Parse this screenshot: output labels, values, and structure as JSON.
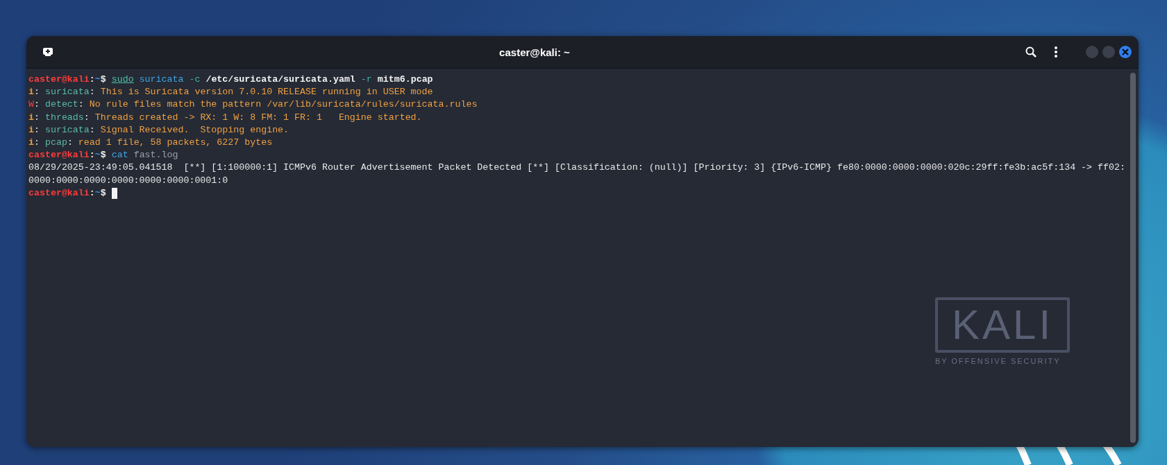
{
  "window": {
    "title": "caster@kali: ~",
    "controls": [
      {
        "kind": "minimize"
      },
      {
        "kind": "maximize"
      },
      {
        "kind": "close"
      }
    ]
  },
  "terminal": {
    "lines": [
      {
        "segments": [
          {
            "kind": "user",
            "text": "caster@kali"
          },
          {
            "kind": "sep",
            "text": ":"
          },
          {
            "kind": "path",
            "text": "~"
          },
          {
            "kind": "sep",
            "text": "$ "
          },
          {
            "kind": "precommand",
            "text": "sudo"
          },
          {
            "kind": "command",
            "text": " suricata"
          },
          {
            "kind": "flag",
            "text": " -c"
          },
          {
            "kind": "arg",
            "text": " /etc/suricata/suricata.yaml"
          },
          {
            "kind": "flag",
            "text": " -r"
          },
          {
            "kind": "arg",
            "text": " mitm6.pcap"
          }
        ]
      },
      {
        "segments": [
          {
            "kind": "info",
            "text": "i"
          },
          {
            "kind": "plain",
            "text": ": "
          },
          {
            "kind": "module",
            "text": "suricata"
          },
          {
            "kind": "plain",
            "text": ": "
          },
          {
            "kind": "message",
            "text": "This is Suricata version 7.0.10 RELEASE running in USER mode"
          }
        ]
      },
      {
        "segments": [
          {
            "kind": "warn",
            "text": "W"
          },
          {
            "kind": "plain",
            "text": ": "
          },
          {
            "kind": "module",
            "text": "detect"
          },
          {
            "kind": "plain",
            "text": ": "
          },
          {
            "kind": "message",
            "text": "No rule files match the pattern /var/lib/suricata/rules/suricata.rules"
          }
        ]
      },
      {
        "segments": [
          {
            "kind": "info",
            "text": "i"
          },
          {
            "kind": "plain",
            "text": ": "
          },
          {
            "kind": "module",
            "text": "threads"
          },
          {
            "kind": "plain",
            "text": ": "
          },
          {
            "kind": "message",
            "text": "Threads created -> RX: 1 W: 8 FM: 1 FR: 1   Engine started."
          }
        ]
      },
      {
        "segments": [
          {
            "kind": "info",
            "text": "i"
          },
          {
            "kind": "plain",
            "text": ": "
          },
          {
            "kind": "module",
            "text": "suricata"
          },
          {
            "kind": "plain",
            "text": ": "
          },
          {
            "kind": "message",
            "text": "Signal Received.  Stopping engine."
          }
        ]
      },
      {
        "segments": [
          {
            "kind": "info",
            "text": "i"
          },
          {
            "kind": "plain",
            "text": ": "
          },
          {
            "kind": "module",
            "text": "pcap"
          },
          {
            "kind": "plain",
            "text": ": "
          },
          {
            "kind": "message",
            "text": "read 1 file, 58 packets, 6227 bytes"
          }
        ]
      },
      {
        "segments": [
          {
            "kind": "user",
            "text": "caster@kali"
          },
          {
            "kind": "sep",
            "text": ":"
          },
          {
            "kind": "path",
            "text": "~"
          },
          {
            "kind": "sep",
            "text": "$ "
          },
          {
            "kind": "command",
            "text": "cat"
          },
          {
            "kind": "dim",
            "text": " fast.log"
          }
        ]
      },
      {
        "segments": [
          {
            "kind": "plain",
            "text": "08/29/2025-23:49:05.041518  [**] [1:100000:1] ICMPv6 Router Advertisement Packet Detected [**] [Classification: (null)] [Priority: 3] {IPv6-ICMP} fe80:0000:0000:0000:020c:29ff:fe3b:ac5f:134 -> ff02:"
          }
        ]
      },
      {
        "segments": [
          {
            "kind": "plain",
            "text": "0000:0000:0000:0000:0000:0000:0001:0"
          }
        ]
      },
      {
        "segments": [
          {
            "kind": "user",
            "text": "caster@kali"
          },
          {
            "kind": "sep",
            "text": ":"
          },
          {
            "kind": "path",
            "text": "~"
          },
          {
            "kind": "sep",
            "text": "$ "
          }
        ],
        "cursor": true
      }
    ]
  },
  "wallpaper": {
    "logo": "KALI",
    "tagline": "BY OFFENSIVE SECURITY"
  }
}
